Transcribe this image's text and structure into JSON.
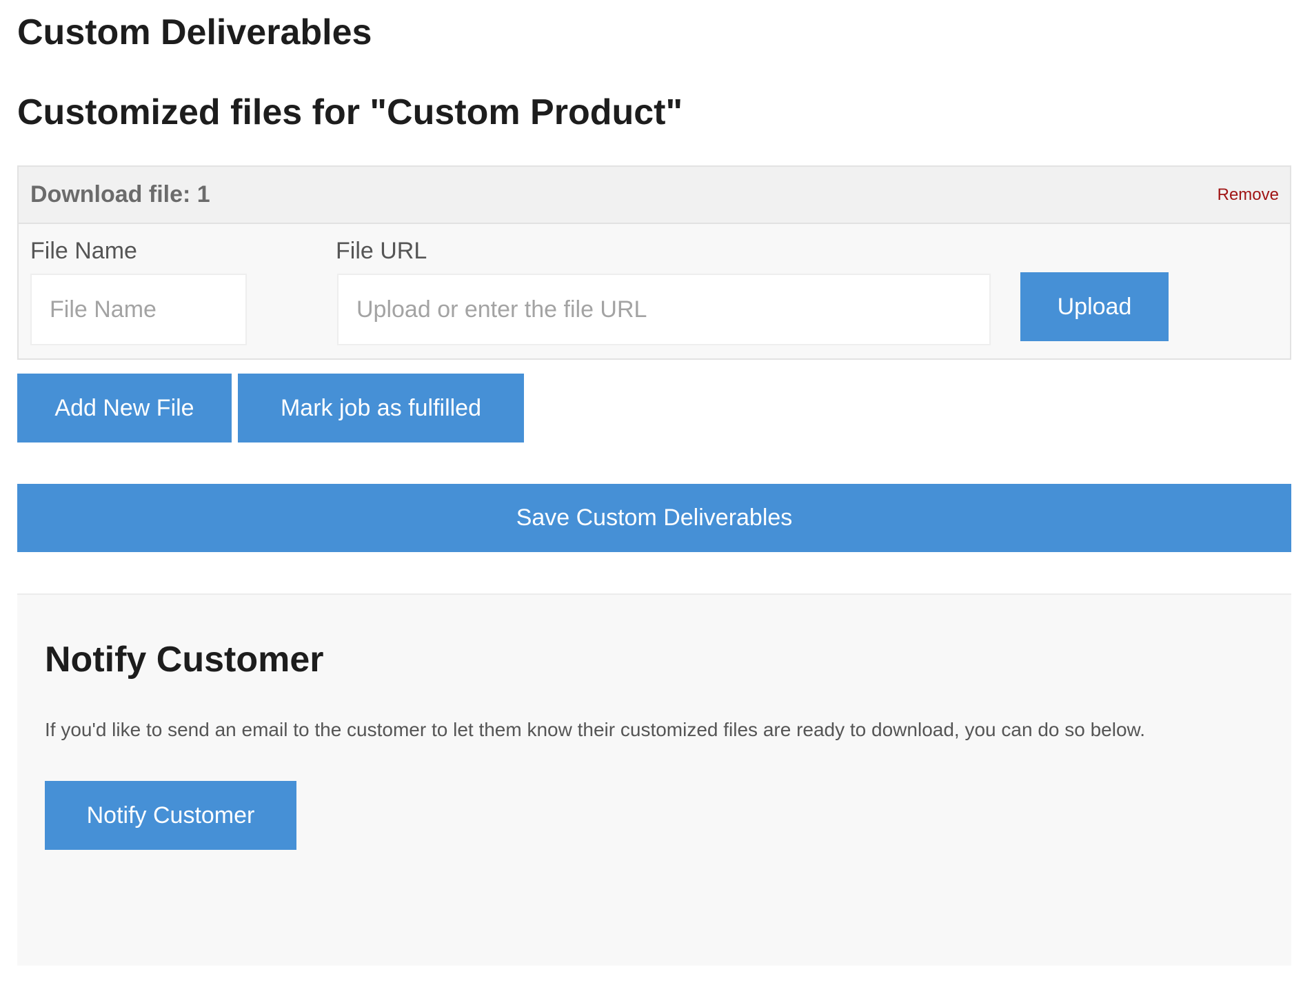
{
  "header": {
    "title": "Custom Deliverables"
  },
  "section": {
    "title": "Customized files for \"Custom Product\""
  },
  "file_block": {
    "title": "Download file: 1",
    "remove_label": "Remove",
    "file_name_label": "File Name",
    "file_name_placeholder": "File Name",
    "file_name_value": "",
    "file_url_label": "File URL",
    "file_url_placeholder": "Upload or enter the file URL",
    "file_url_value": "",
    "upload_label": "Upload"
  },
  "actions": {
    "add_file_label": "Add New File",
    "mark_fulfilled_label": "Mark job as fulfilled",
    "save_label": "Save Custom Deliverables"
  },
  "notify": {
    "title": "Notify Customer",
    "description": "If you'd like to send an email to the customer to let them know their customized files are ready to download, you can do so below.",
    "button_label": "Notify Customer"
  },
  "colors": {
    "accent": "#4690d6",
    "remove_link": "#a01515",
    "panel_bg": "#f8f8f8",
    "header_bg": "#f1f1f1"
  }
}
